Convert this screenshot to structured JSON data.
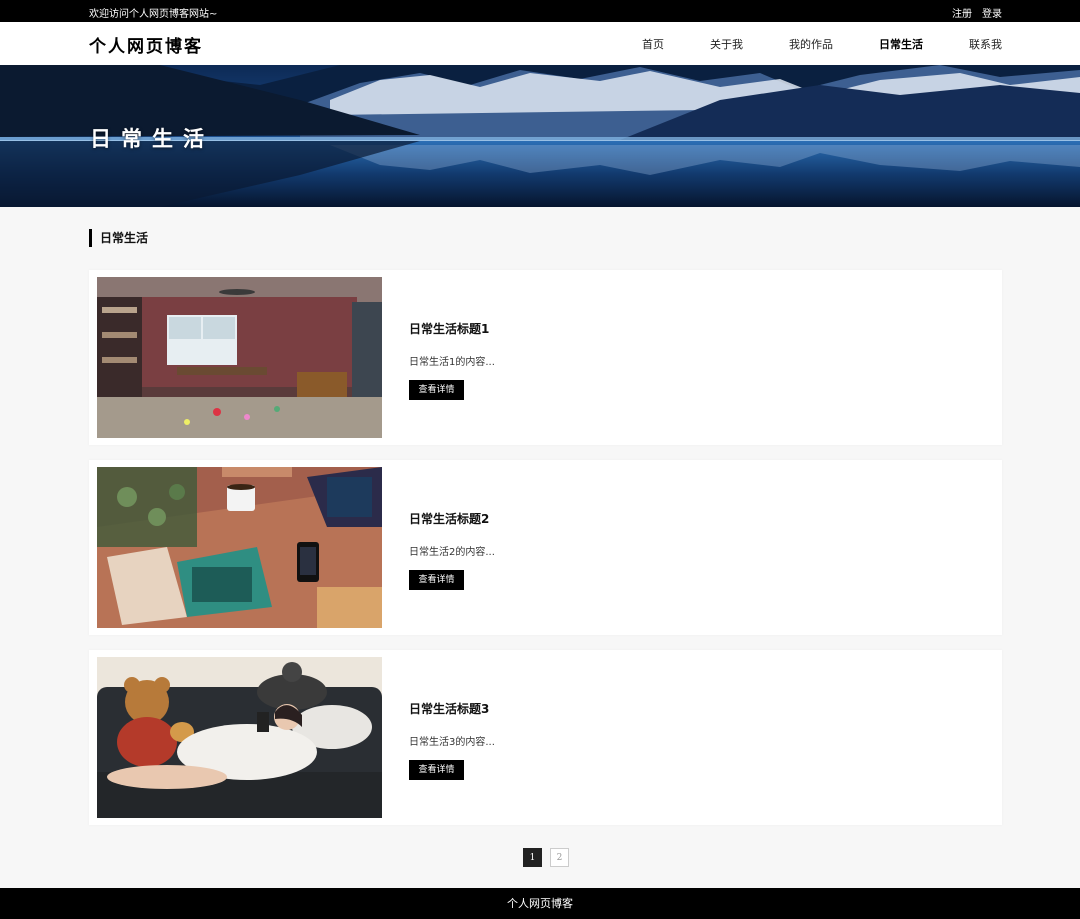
{
  "topbar": {
    "welcome": "欢迎访问个人网页博客网站~",
    "register": "注册",
    "login": "登录"
  },
  "header": {
    "logo": "个人网页博客",
    "nav": [
      "首页",
      "关于我",
      "我的作品",
      "日常生活",
      "联系我"
    ],
    "active_index": 3
  },
  "banner": {
    "title": "日常生活"
  },
  "section": {
    "title": "日常生活"
  },
  "posts": [
    {
      "title": "日常生活标题1",
      "desc": "日常生活1的内容...",
      "button": "查看详情",
      "image": "cluttered-bedroom-illustration"
    },
    {
      "title": "日常生活标题2",
      "desc": "日常生活2的内容...",
      "button": "查看详情",
      "image": "desk-with-coffee-illustration"
    },
    {
      "title": "日常生活标题3",
      "desc": "日常生活3的内容...",
      "button": "查看详情",
      "image": "girl-on-sofa-with-cat-illustration"
    }
  ],
  "pagination": {
    "current": "1",
    "next": "2"
  },
  "footer": {
    "text": "个人网页博客"
  },
  "colors": {
    "dark": "#000000",
    "background": "#f7f7f7",
    "card": "#ffffff"
  }
}
